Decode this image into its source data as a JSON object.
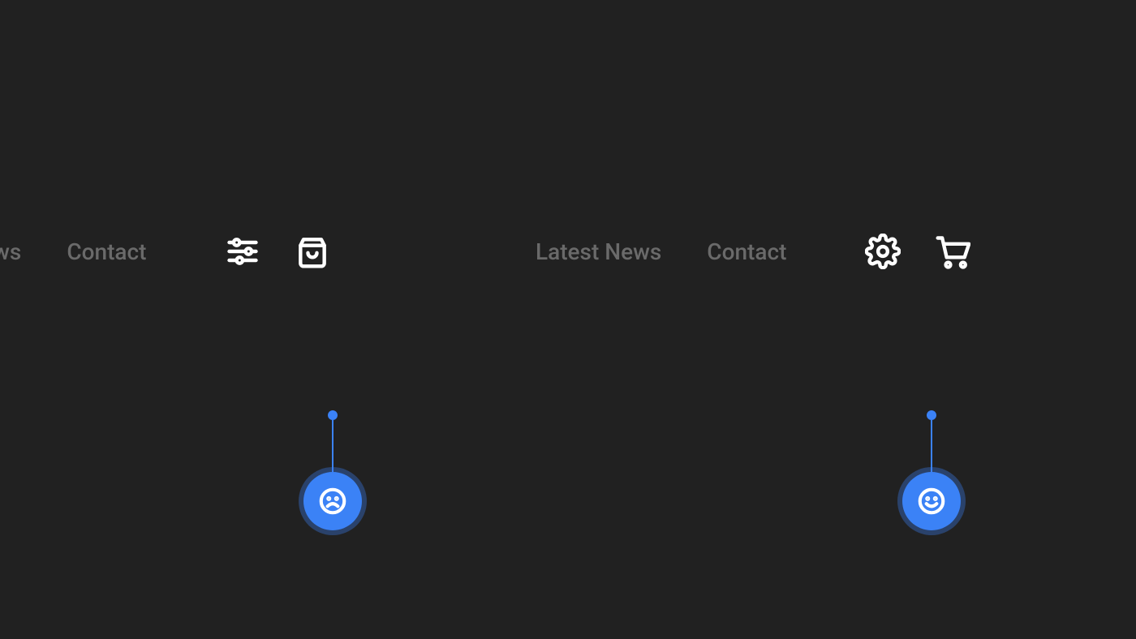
{
  "panels": {
    "left": {
      "nav_news": "t News",
      "nav_contact": "Contact",
      "icon1": "sliders",
      "icon2": "shopping-bag",
      "mood": "frown"
    },
    "right": {
      "nav_news": "Latest News",
      "nav_contact": "Contact",
      "icon1": "settings",
      "icon2": "shopping-cart",
      "mood": "smile"
    }
  },
  "colors": {
    "bg": "#212121",
    "accent": "#3b82f6",
    "nav_text": "#6a6a6a",
    "icon": "#ffffff"
  }
}
